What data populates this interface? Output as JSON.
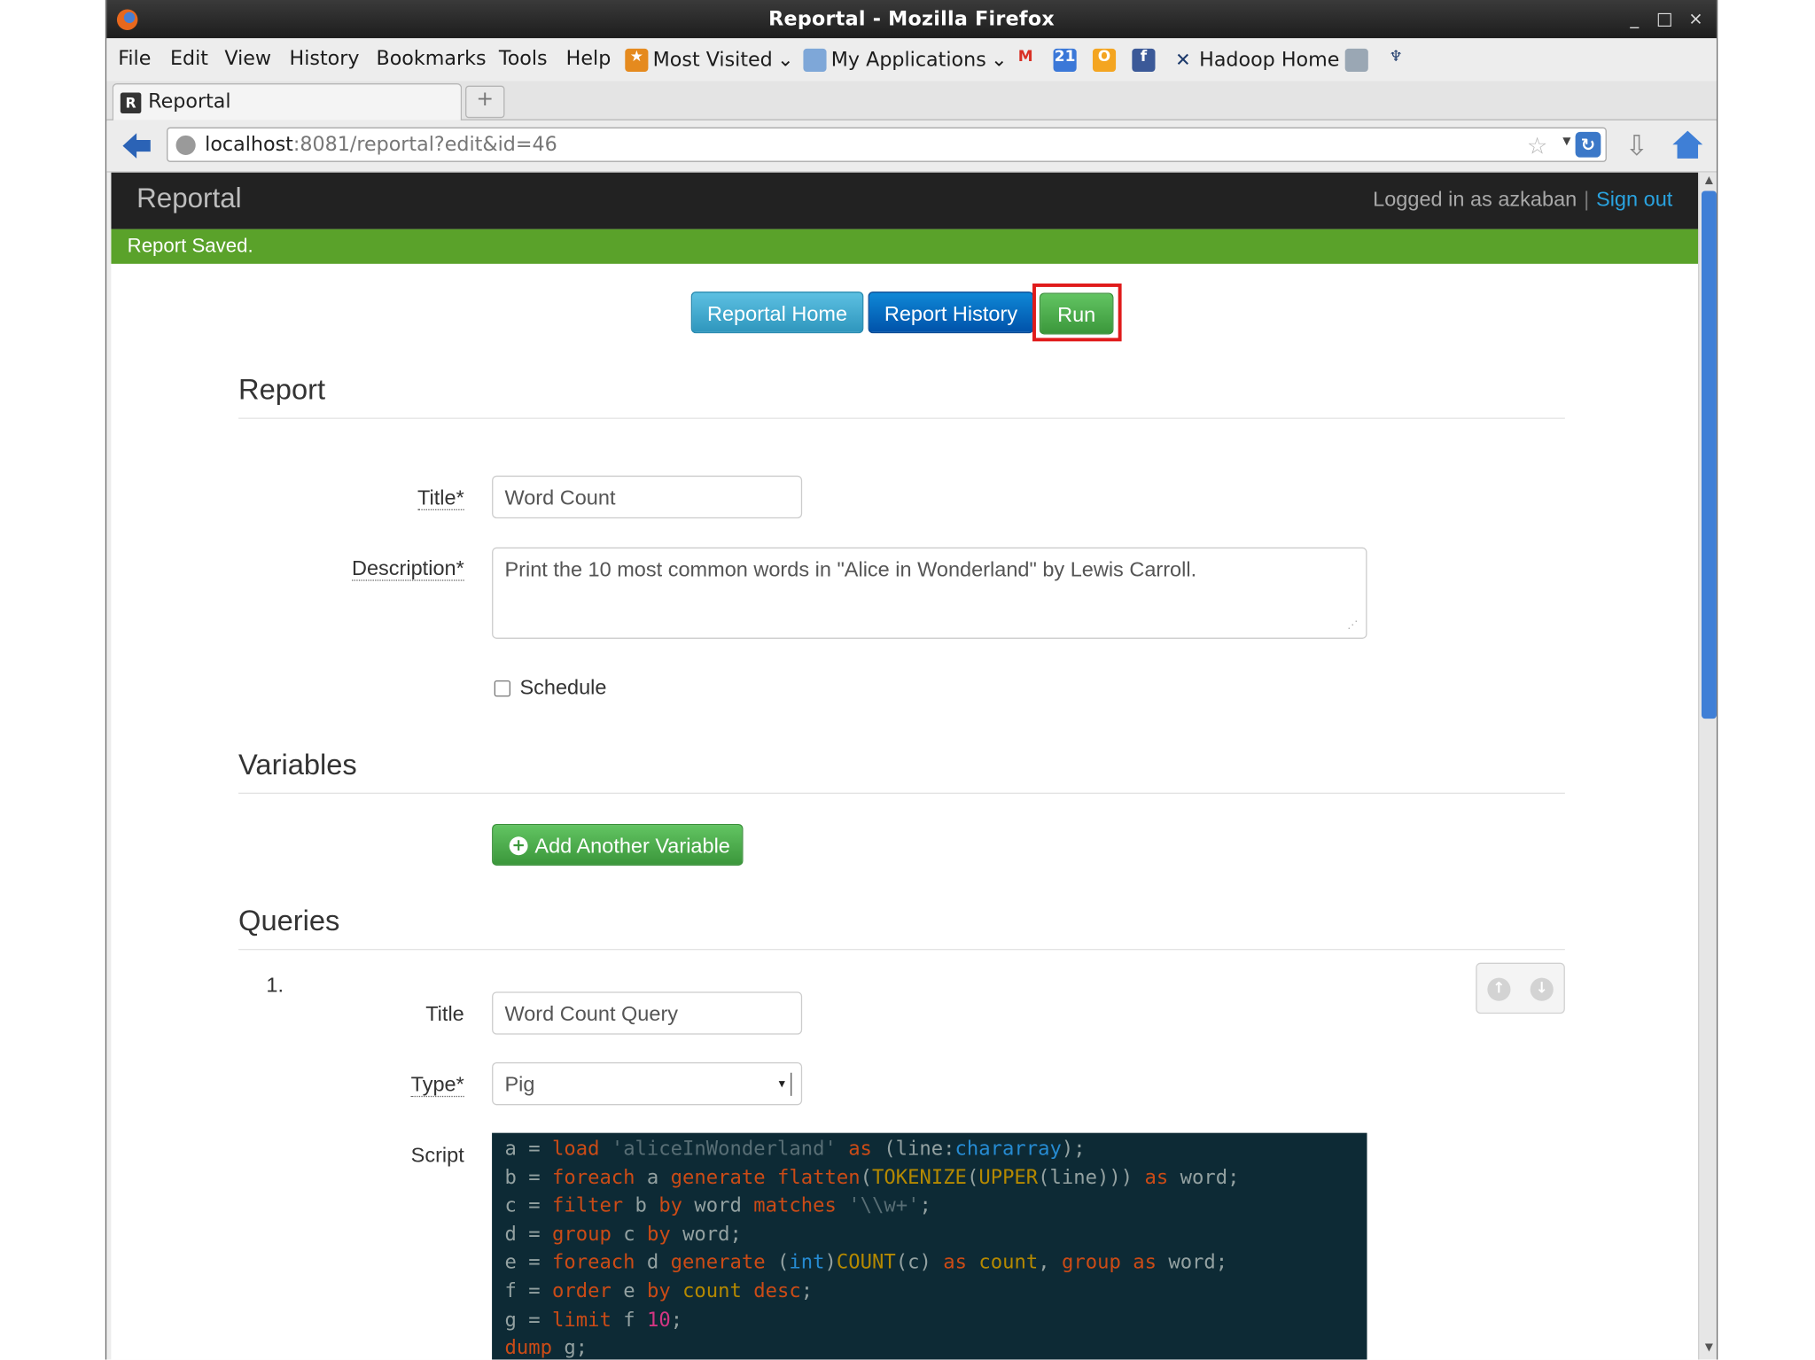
{
  "window": {
    "title": "Reportal - Mozilla Firefox",
    "controls": [
      "_",
      "□",
      "×"
    ]
  },
  "menu": [
    "File",
    "Edit",
    "View",
    "History",
    "Bookmarks",
    "Tools",
    "Help"
  ],
  "bookmarks": {
    "most_visited": "Most Visited",
    "my_applications": "My Applications",
    "hadoop_home": "Hadoop Home"
  },
  "tab": {
    "label": "Reportal",
    "new_tab": "+"
  },
  "address": {
    "host": "localhost",
    "rest": ":8081/reportal?edit&id=46"
  },
  "app": {
    "brand": "Reportal",
    "logged_in": "Logged in as azkaban",
    "separator": "|",
    "sign_out": "Sign out",
    "alert": "Report Saved."
  },
  "actions": {
    "home": "Reportal Home",
    "history": "Report History",
    "run": "Run"
  },
  "report": {
    "heading": "Report",
    "title_label": "Title*",
    "title_value": "Word Count",
    "description_label": "Description*",
    "description_value": "Print the 10 most common words in \"Alice in Wonderland\" by Lewis Carroll.",
    "schedule_label": "Schedule"
  },
  "variables": {
    "heading": "Variables",
    "add_button": "Add Another Variable"
  },
  "queries": {
    "heading": "Queries",
    "items": [
      {
        "number": "1.",
        "title_label": "Title",
        "title_value": "Word Count Query",
        "type_label": "Type*",
        "type_value": "Pig",
        "script_label": "Script",
        "script_lines": [
          [
            [
              "v",
              "a "
            ],
            [
              "op",
              "= "
            ],
            [
              "kw",
              "load "
            ],
            [
              "str",
              "'aliceInWonderland' "
            ],
            [
              "kw",
              "as "
            ],
            [
              "v",
              "(line:"
            ],
            [
              "ty",
              "chararray"
            ],
            [
              "v",
              ");"
            ]
          ],
          [
            [
              "v",
              "b "
            ],
            [
              "op",
              "= "
            ],
            [
              "kw",
              "foreach "
            ],
            [
              "v",
              "a "
            ],
            [
              "kw",
              "generate "
            ],
            [
              "kw",
              "flatten"
            ],
            [
              "v",
              "("
            ],
            [
              "fn",
              "TOKENIZE"
            ],
            [
              "v",
              "("
            ],
            [
              "fn",
              "UPPER"
            ],
            [
              "v",
              "(line))) "
            ],
            [
              "kw",
              "as "
            ],
            [
              "v",
              "word;"
            ]
          ],
          [
            [
              "v",
              "c "
            ],
            [
              "op",
              "= "
            ],
            [
              "kw",
              "filter "
            ],
            [
              "v",
              "b "
            ],
            [
              "kw",
              "by "
            ],
            [
              "v",
              "word "
            ],
            [
              "kw",
              "matches "
            ],
            [
              "str",
              "'\\\\w+'"
            ],
            [
              "v",
              ";"
            ]
          ],
          [
            [
              "v",
              "d "
            ],
            [
              "op",
              "= "
            ],
            [
              "kw",
              "group "
            ],
            [
              "v",
              "c "
            ],
            [
              "kw",
              "by "
            ],
            [
              "v",
              "word;"
            ]
          ],
          [
            [
              "v",
              "e "
            ],
            [
              "op",
              "= "
            ],
            [
              "kw",
              "foreach "
            ],
            [
              "v",
              "d "
            ],
            [
              "kw",
              "generate "
            ],
            [
              "v",
              "("
            ],
            [
              "ty",
              "int"
            ],
            [
              "v",
              ")"
            ],
            [
              "fn",
              "COUNT"
            ],
            [
              "v",
              "(c) "
            ],
            [
              "kw",
              "as "
            ],
            [
              "fn",
              "count"
            ],
            [
              "v",
              ", "
            ],
            [
              "kw",
              "group "
            ],
            [
              "kw",
              "as "
            ],
            [
              "v",
              "word;"
            ]
          ],
          [
            [
              "v",
              "f "
            ],
            [
              "op",
              "= "
            ],
            [
              "kw",
              "order "
            ],
            [
              "v",
              "e "
            ],
            [
              "kw",
              "by "
            ],
            [
              "fn",
              "count "
            ],
            [
              "kw",
              "desc"
            ],
            [
              "v",
              ";"
            ]
          ],
          [
            [
              "v",
              "g "
            ],
            [
              "op",
              "= "
            ],
            [
              "kw",
              "limit "
            ],
            [
              "v",
              "f "
            ],
            [
              "num",
              "10"
            ],
            [
              "v",
              ";"
            ]
          ],
          [
            [
              "kw",
              "dump "
            ],
            [
              "v",
              "g;"
            ]
          ]
        ]
      }
    ]
  }
}
